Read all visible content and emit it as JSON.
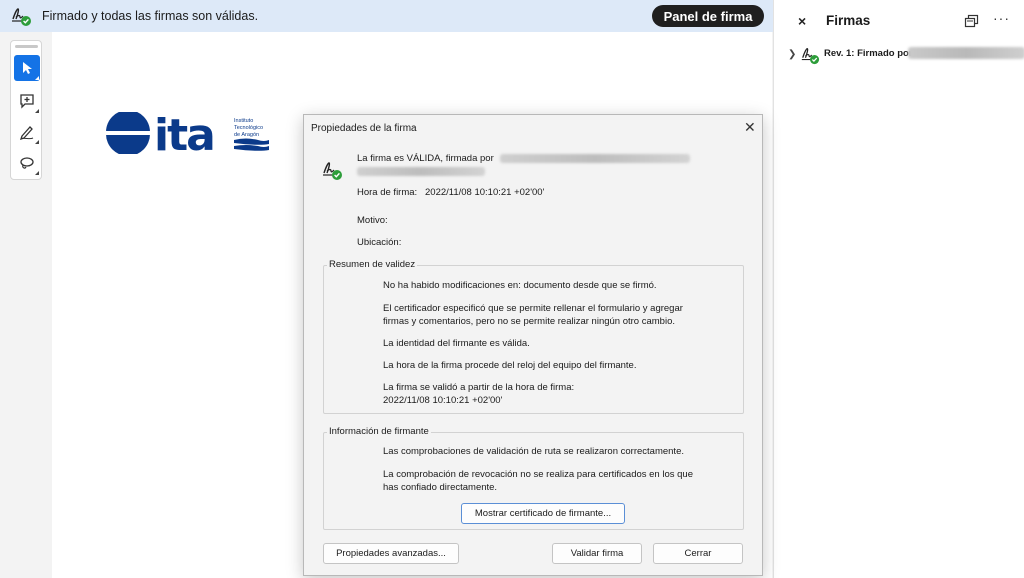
{
  "banner": {
    "text": "Firmado y todas las firmas son válidas.",
    "panel_button": "Panel de firma"
  },
  "logo": {
    "brand": "ita",
    "subtitle_line1": "Instituto",
    "subtitle_line2": "Tecnológico",
    "subtitle_line3": "de Aragón"
  },
  "toolbar": {
    "tools": [
      "select-tool",
      "add-comment-tool",
      "draw-tool",
      "lasso-tool"
    ]
  },
  "right_panel": {
    "close": "×",
    "title": "Firmas",
    "more": "···",
    "rev_label": "Rev. 1: Firmado por"
  },
  "dialog": {
    "title": "Propiedades de la firma",
    "close": "✕",
    "valid_line": "La firma es VÁLIDA, firmada por",
    "sign_time_label": "Hora de firma:",
    "sign_time_value": "2022/11/08 10:10:21 +02'00'",
    "reason_label": "Motivo:",
    "location_label": "Ubicación:",
    "summary": {
      "legend": "Resumen de validez",
      "line1": "No ha habido modificaciones en: documento desde que se firmó.",
      "line2a": "El certificador especificó que se permite rellenar el formulario y agregar",
      "line2b": "firmas y comentarios, pero no se permite realizar ningún otro cambio.",
      "line3": "La identidad del firmante es válida.",
      "line4": "La hora de la firma procede del reloj del equipo del firmante.",
      "line5a": "La firma se validó a partir de la hora de firma:",
      "line5b": "2022/11/08 10:10:21 +02'00'"
    },
    "signer_info": {
      "legend": "Información de firmante",
      "line1": "Las comprobaciones de validación de ruta se realizaron correctamente.",
      "line2a": "La comprobación de revocación no se realiza para certificados en los que",
      "line2b": "has confiado directamente.",
      "show_cert_button": "Mostrar certificado de firmante..."
    },
    "buttons": {
      "advanced": "Propiedades avanzadas...",
      "validate": "Validar firma",
      "close": "Cerrar"
    }
  },
  "colors": {
    "banner_bg": "#dde9f8",
    "accent_blue": "#1473e6",
    "logo_blue": "#0b3a8a",
    "valid_green": "#2d9d3a"
  }
}
